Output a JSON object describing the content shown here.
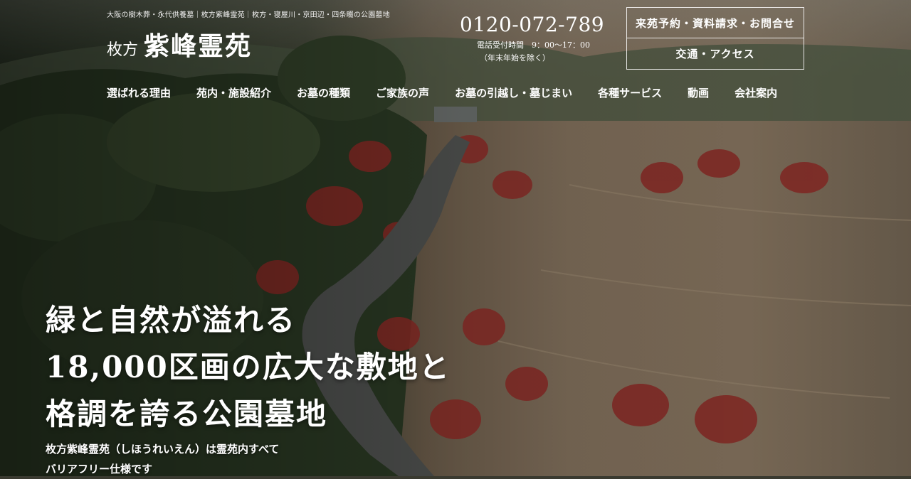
{
  "header": {
    "tagline": "大阪の樹木葬・永代供養墓｜枚方紫峰霊苑｜枚方・寝屋川・京田辺・四条畷の公園墓地",
    "logo_prefix": "枚方",
    "logo_name": "紫峰霊苑",
    "phone": {
      "number": "0120-072-789",
      "hours": "電話受付時間　9：00〜17：00",
      "note": "（年末年始を除く）"
    },
    "cta": {
      "primary": "来苑予約・資料請求・お問合せ",
      "secondary": "交通・アクセス"
    }
  },
  "nav": {
    "items": [
      {
        "label": "選ばれる理由"
      },
      {
        "label": "苑内・施設紹介"
      },
      {
        "label": "お墓の種類"
      },
      {
        "label": "ご家族の声"
      },
      {
        "label": "お墓の引越し・墓じまい"
      },
      {
        "label": "各種サービス"
      },
      {
        "label": "動画"
      },
      {
        "label": "会社案内"
      }
    ]
  },
  "hero": {
    "headline": [
      "緑と自然が溢れる",
      "18,000区画の広大な敷地と",
      "格調を誇る公園墓地"
    ],
    "subcopy": [
      "枚方紫峰霊苑（しほうれいえん）は霊苑内すべて",
      "バリアフリー仕様です"
    ]
  }
}
